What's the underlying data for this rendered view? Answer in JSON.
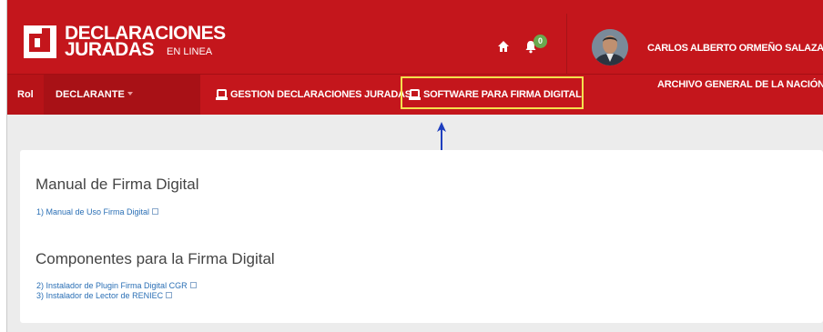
{
  "header": {
    "logo_line1": "DECLARACIONES",
    "logo_line2": "JURADAS",
    "logo_line3": "EN LINEA",
    "notification_count": "0",
    "user_name": "CARLOS ALBERTO ORMEÑO SALAZAR",
    "colors": {
      "primary": "#c4161c",
      "badge": "#6aa84f",
      "highlight_border": "#f4e04d",
      "arrow": "#1f3fbf"
    }
  },
  "nav": {
    "rol_label": "Rol",
    "declarante_label": "DECLARANTE",
    "gestion_label": "GESTION DECLARACIONES JURADAS",
    "software_label": "SOFTWARE PARA FIRMA DIGITAL",
    "archivo_label": "ARCHIVO GENERAL DE LA NACIÓN"
  },
  "content": {
    "section1_title": "Manual de Firma Digital",
    "section1_links": [
      "1) Manual de Uso Firma Digital"
    ],
    "section2_title": "Componentes para la Firma Digital",
    "section2_links": [
      "2) Instalador de Plugin Firma Digital CGR",
      "3) Instalador de Lector de RENIEC"
    ]
  }
}
